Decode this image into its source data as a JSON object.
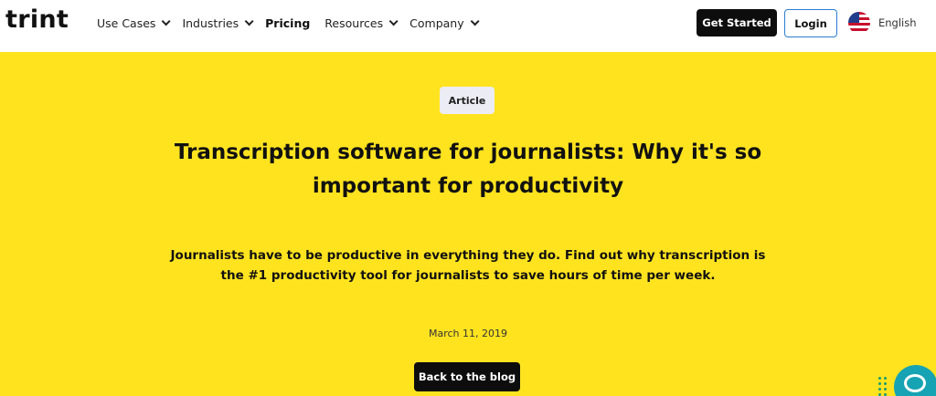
{
  "brand": {
    "logo_text": "trint"
  },
  "nav": {
    "items": [
      {
        "label": "Use Cases",
        "dropdown": true
      },
      {
        "label": "Industries",
        "dropdown": true
      },
      {
        "label": "Pricing",
        "dropdown": false
      },
      {
        "label": "Resources",
        "dropdown": true
      },
      {
        "label": "Company",
        "dropdown": true
      }
    ],
    "get_started_label": "Get Started",
    "login_label": "Login",
    "language_label": "English",
    "language_icon": "us-flag-icon"
  },
  "hero": {
    "badge": "Article",
    "title": "Transcription software for journalists: Why it's so important for productivity",
    "subtitle": "Journalists have to be productive in everything they do. Find out why transcription is the #1 productivity tool for journalists to save hours of time per week.",
    "date": "March 11, 2019",
    "back_label": "Back to the blog"
  },
  "colors": {
    "hero_background": "#ffe31f",
    "primary_button": "#0d0d0d",
    "login_border": "#2a7dd1",
    "chat_widget": "#16a3b3"
  },
  "widgets": {
    "chat_icon": "chat-bubble-icon",
    "grip_icon": "drag-grip-icon"
  }
}
